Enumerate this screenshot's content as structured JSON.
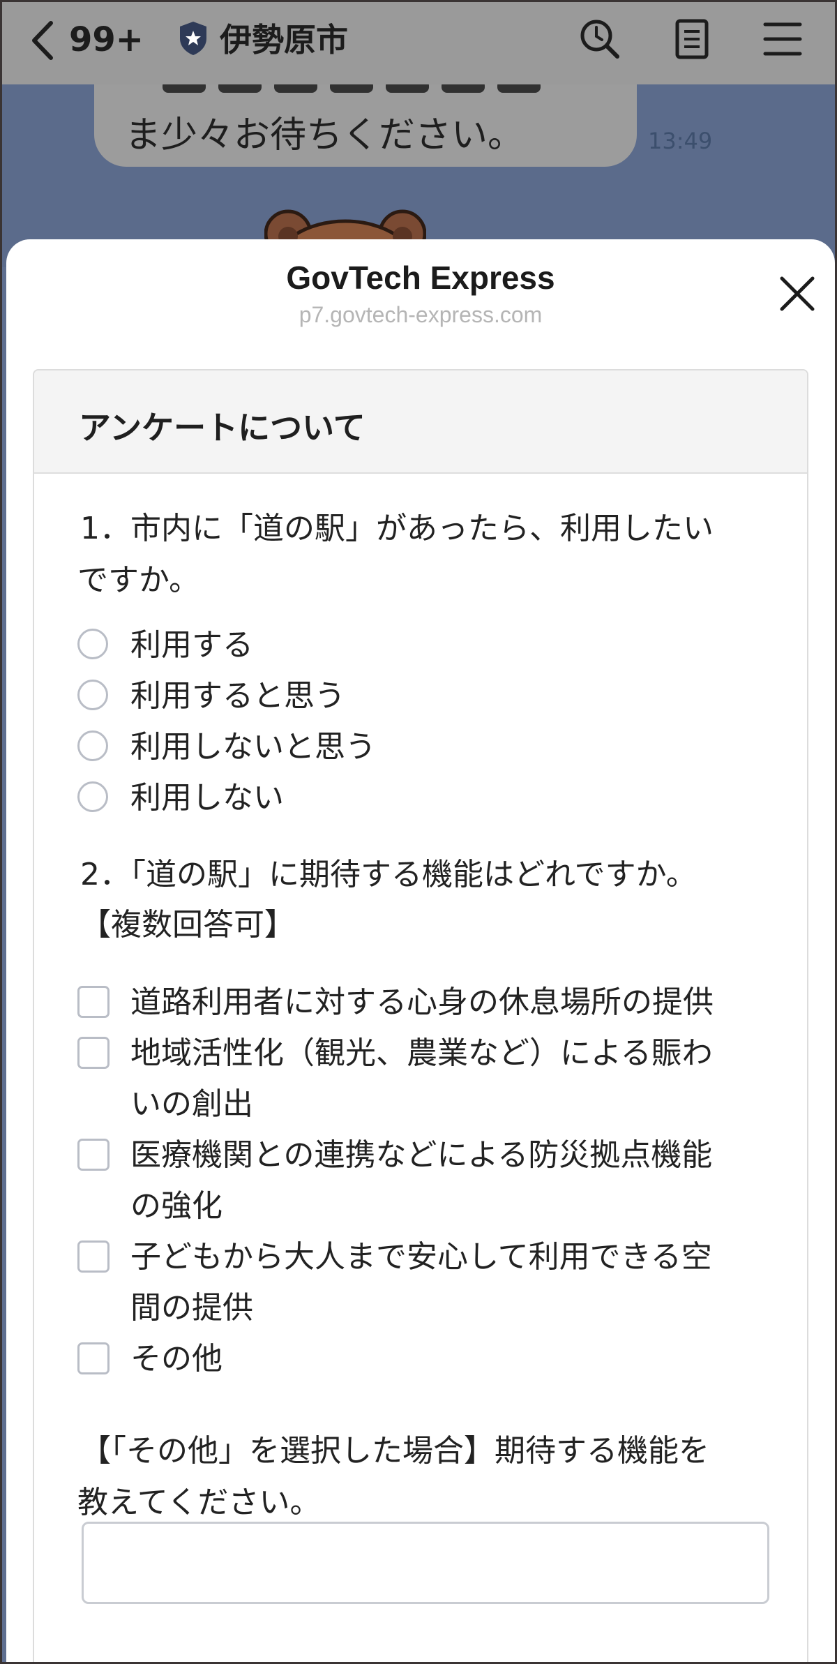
{
  "navbar": {
    "back_count": "99+",
    "account_name": "伊勢原市",
    "icons": [
      "back-chevron-icon",
      "shield-star-icon",
      "search-icon",
      "notes-icon",
      "menu-icon"
    ]
  },
  "chat": {
    "message_line": "ま少々お待ちください。",
    "time": "13:49"
  },
  "sheet": {
    "title": "GovTech Express",
    "url": "p7.govtech-express.com"
  },
  "form": {
    "header": "アンケートについて",
    "q1": {
      "line1": "1．市内に「道の駅」があったら、利用したい",
      "line2": "ですか。",
      "options": [
        "利用する",
        "利用すると思う",
        "利用しないと思う",
        "利用しない"
      ]
    },
    "q2": {
      "line1": "2．「道の駅」に期待する機能はどれですか。",
      "line2": "【複数回答可】",
      "options": [
        {
          "line1": "道路利用者に対する心身の休息場所の提供",
          "line2": ""
        },
        {
          "line1": "地域活性化（観光、農業など）による賑わ",
          "line2": "いの創出"
        },
        {
          "line1": "医療機関との連携などによる防災拠点機能",
          "line2": "の強化"
        },
        {
          "line1": "子どもから大人まで安心して利用できる空",
          "line2": "間の提供"
        },
        {
          "line1": "その他",
          "line2": ""
        }
      ]
    },
    "other": {
      "line1": "【「その他」を選択した場合】期待する機能を",
      "line2": "教えてください。",
      "value": ""
    }
  },
  "colors": {
    "overlay_navbar": "#9a9a9a",
    "chat_background": "#5b6b8b",
    "control_border": "#b9bdc6"
  }
}
